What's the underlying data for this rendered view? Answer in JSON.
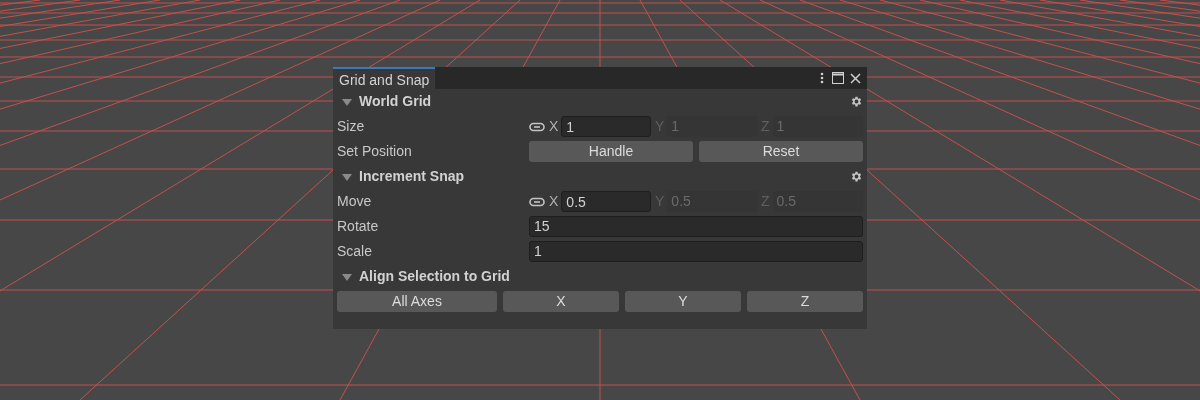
{
  "window": {
    "title": "Grid and Snap",
    "selected": true
  },
  "sections": [
    {
      "title": "World Grid",
      "expanded": true,
      "settings": true,
      "rows": [
        {
          "kind": "vector",
          "label": "Size",
          "linked": true,
          "axes": [
            {
              "label": "X",
              "value": "1",
              "disabled": false
            },
            {
              "label": "Y",
              "value": "1",
              "disabled": true
            },
            {
              "label": "Z",
              "value": "1",
              "disabled": true
            }
          ]
        },
        {
          "kind": "buttons",
          "label": "Set Position",
          "buttons": [
            "Handle",
            "Reset"
          ]
        }
      ]
    },
    {
      "title": "Increment Snap",
      "expanded": true,
      "settings": true,
      "rows": [
        {
          "kind": "vector",
          "label": "Move",
          "linked": true,
          "axes": [
            {
              "label": "X",
              "value": "0.5",
              "disabled": false
            },
            {
              "label": "Y",
              "value": "0.5",
              "disabled": true
            },
            {
              "label": "Z",
              "value": "0.5",
              "disabled": true
            }
          ]
        },
        {
          "kind": "number",
          "label": "Rotate",
          "value": "15"
        },
        {
          "kind": "number",
          "label": "Scale",
          "value": "1"
        }
      ]
    },
    {
      "title": "Align Selection to Grid",
      "expanded": true,
      "settings": false,
      "rows": [
        {
          "kind": "axis_buttons",
          "buttons": [
            "All Axes",
            "X",
            "Y",
            "Z"
          ]
        }
      ]
    }
  ]
}
